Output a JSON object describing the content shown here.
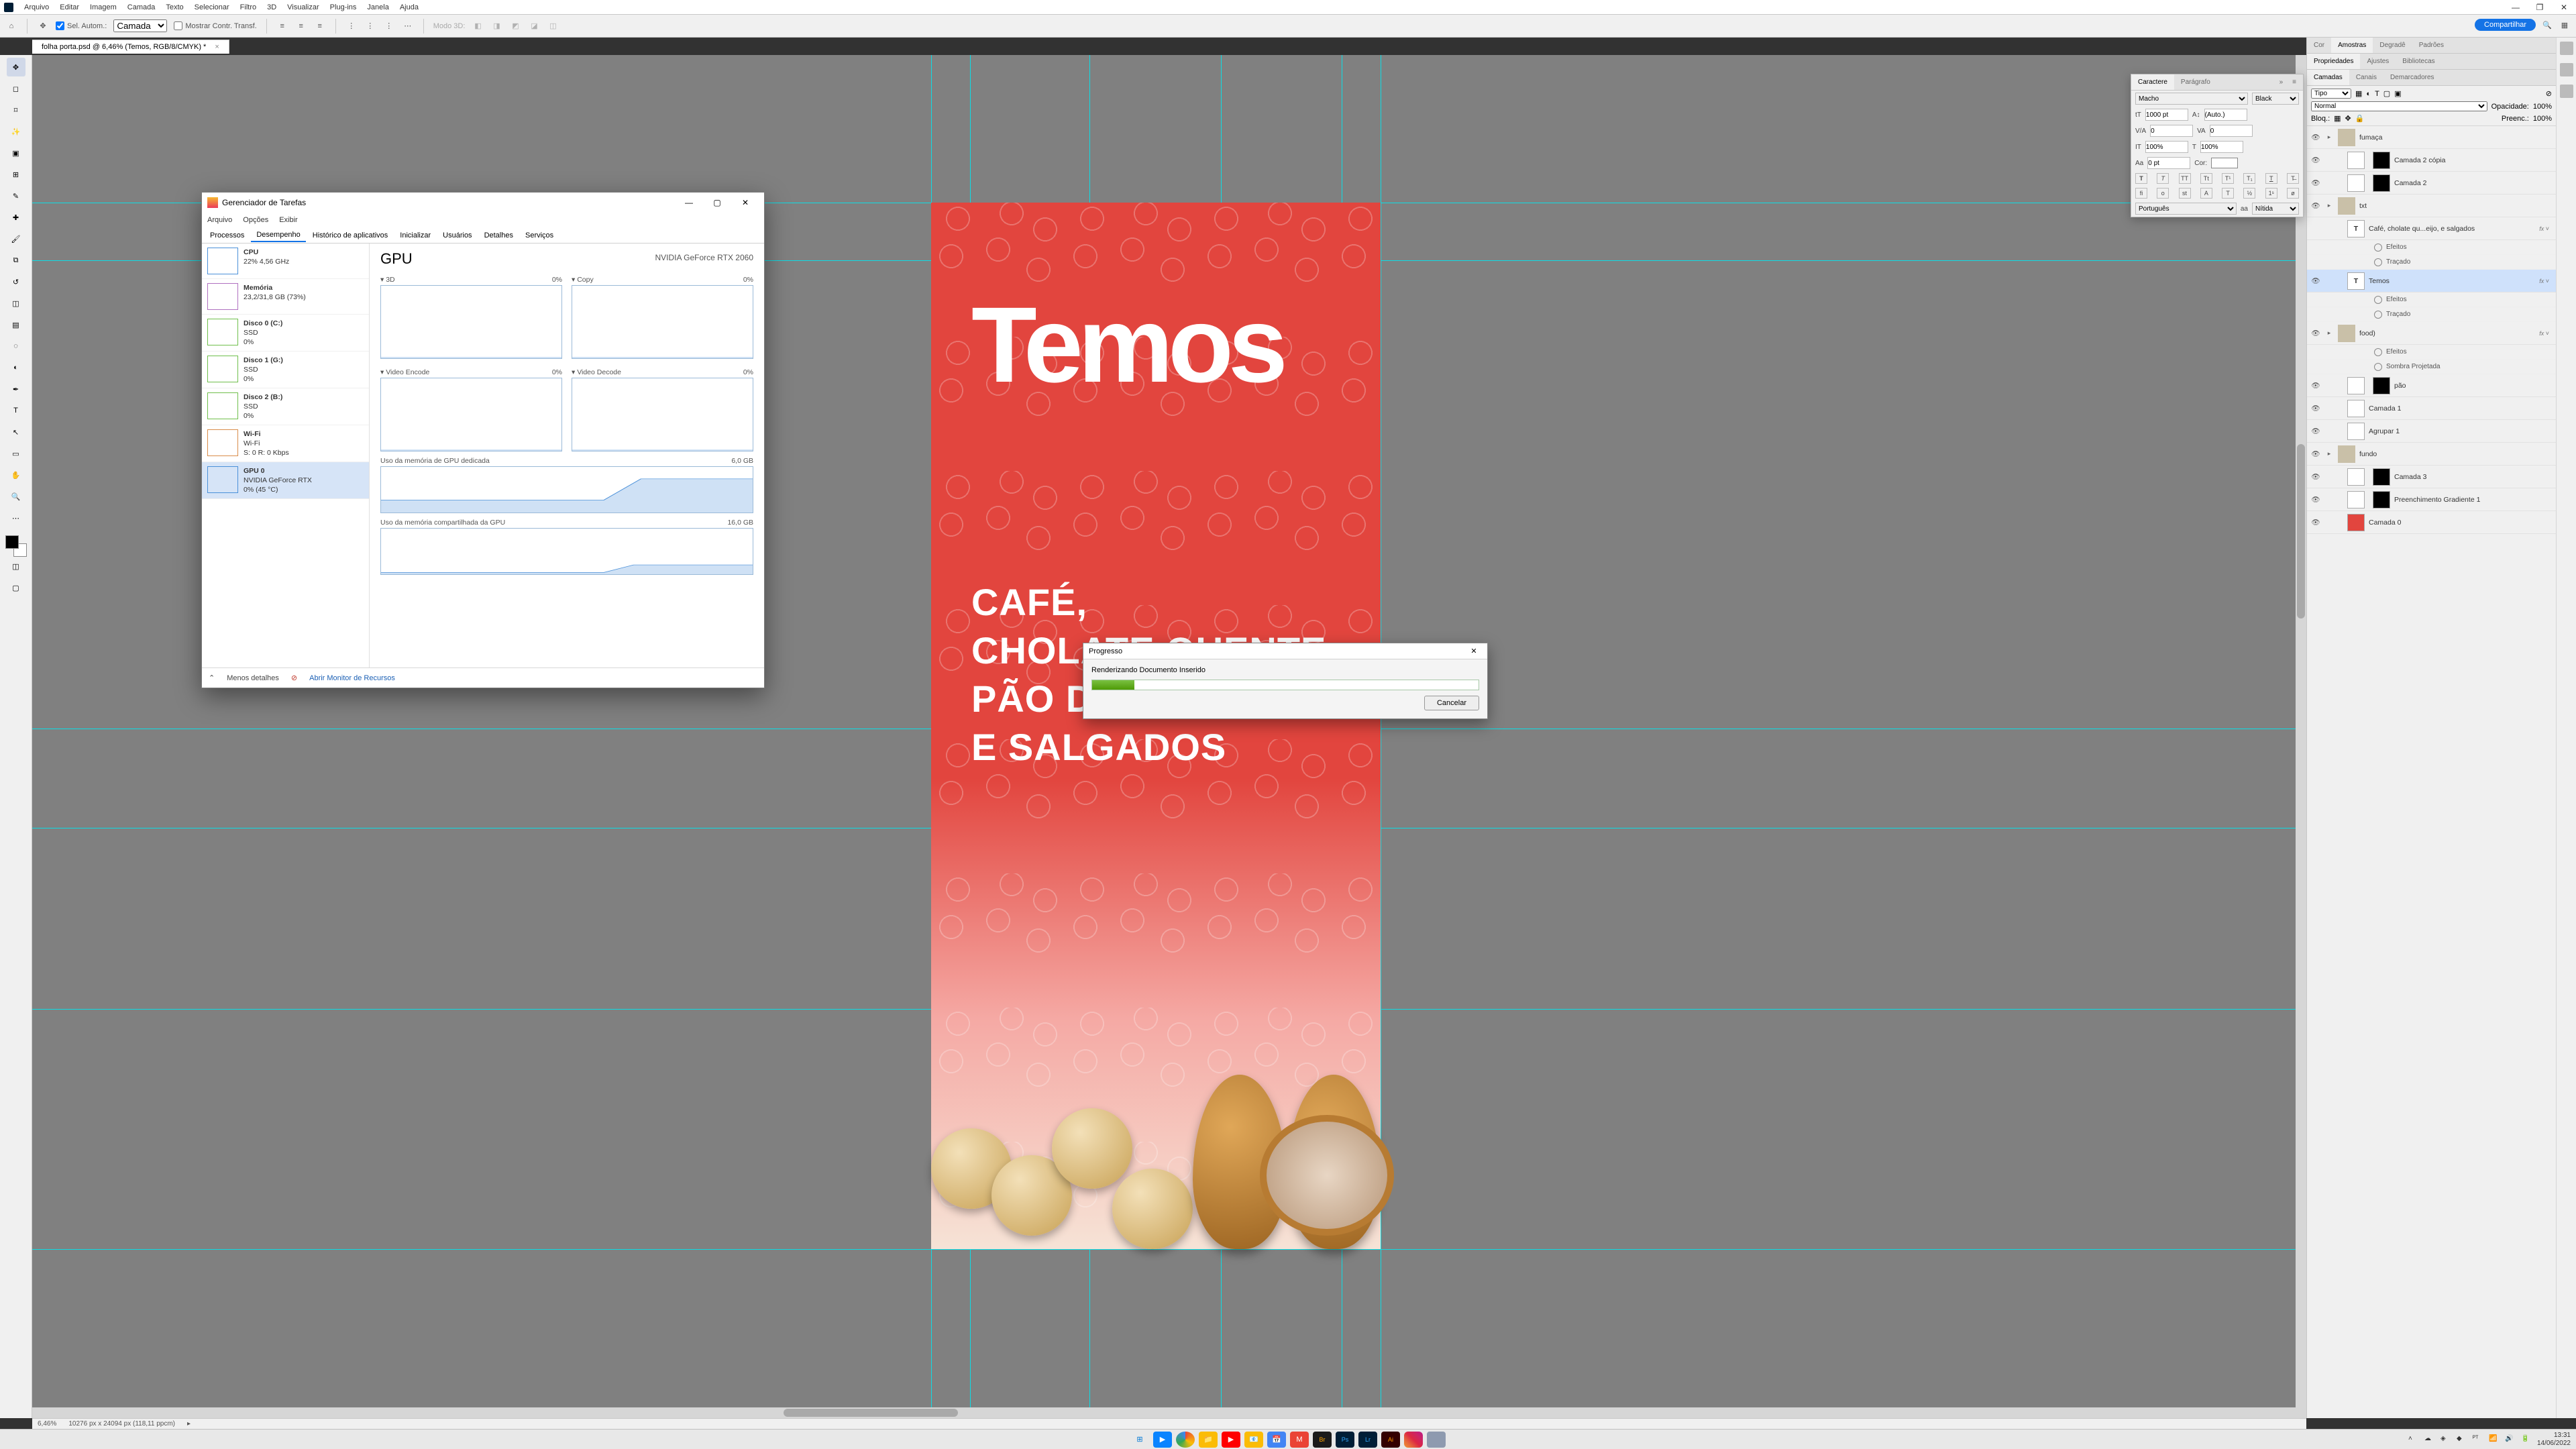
{
  "menubar": {
    "items": [
      "Arquivo",
      "Editar",
      "Imagem",
      "Camada",
      "Texto",
      "Selecionar",
      "Filtro",
      "3D",
      "Visualizar",
      "Plug-ins",
      "Janela",
      "Ajuda"
    ]
  },
  "window_buttons": {
    "minimize": "—",
    "restore": "❐",
    "close": "✕"
  },
  "optionsbar": {
    "auto_select_label": "Sel. Autom.:",
    "auto_select_dropdown": "Camada",
    "show_transform": "Mostrar Contr. Transf.",
    "mode_label": "Modo 3D:"
  },
  "share_button": "Compartilhar",
  "doc_tab": "folha porta.psd @ 6,46% (Temos, RGB/8/CMYK) *",
  "statusbar": {
    "zoom": "6,46%",
    "dims": "10276 px x 24094 px (118,11 ppcm)"
  },
  "char_panel": {
    "tabs": [
      "Caractere",
      "Parágrafo"
    ],
    "font_family": "Macho",
    "font_style": "Black",
    "font_size": "1000 pt",
    "leading": "(Auto.)",
    "va_metric": "0",
    "va_optical": "0",
    "vert_scale": "100%",
    "horz_scale": "100%",
    "baseline": "0 pt",
    "color_label": "Cor:",
    "lang": "Português",
    "aa": "Nítida"
  },
  "right_strip_top_tabs": [
    "Cor",
    "Amostras",
    "Degradê",
    "Padrões"
  ],
  "right_strip_mid_tabs": [
    "Propriedades",
    "Ajustes",
    "Bibliotecas"
  ],
  "layers_panel": {
    "tabs": [
      "Camadas",
      "Canais",
      "Demarcadores"
    ],
    "kind_label": "Tipo",
    "search_placeholder": "",
    "blend_mode": "Normal",
    "opacity_label": "Opacidade:",
    "opacity_value": "100%",
    "lock_label": "Bloq.:",
    "fill_label": "Preenc.:",
    "fill_value": "100%",
    "layers": [
      {
        "kind": "group",
        "name": "fumaça",
        "visible": true
      },
      {
        "kind": "raster",
        "name": "Camada 2 cópia",
        "visible": true,
        "masked": true
      },
      {
        "kind": "raster",
        "name": "Camada 2",
        "visible": true,
        "masked": true
      },
      {
        "kind": "group",
        "name": "txt",
        "visible": true
      },
      {
        "kind": "text",
        "name": "Café, cholate qu...eijo, e salgados",
        "visible": false,
        "fx": true
      },
      {
        "kind": "fxline",
        "name": "Efeitos"
      },
      {
        "kind": "fxline",
        "name": "Traçado"
      },
      {
        "kind": "text",
        "name": "Temos",
        "visible": true,
        "selected": true,
        "fx": true
      },
      {
        "kind": "fxline",
        "name": "Efeitos"
      },
      {
        "kind": "fxline",
        "name": "Traçado"
      },
      {
        "kind": "group",
        "name": "food)",
        "visible": true,
        "fx": true
      },
      {
        "kind": "fxline",
        "name": "Efeitos"
      },
      {
        "kind": "fxline",
        "name": "Sombra Projetada"
      },
      {
        "kind": "raster",
        "name": "pão",
        "visible": true,
        "masked": true
      },
      {
        "kind": "raster",
        "name": "Camada 1",
        "visible": true
      },
      {
        "kind": "raster",
        "name": "Agrupar 1",
        "visible": true
      },
      {
        "kind": "group",
        "name": "fundo",
        "visible": true
      },
      {
        "kind": "raster",
        "name": "Camada 3",
        "visible": true,
        "masked": true
      },
      {
        "kind": "adjust",
        "name": "Preenchimento Gradiente 1",
        "visible": true,
        "masked": true
      },
      {
        "kind": "solid",
        "name": "Camada 0",
        "visible": true
      }
    ]
  },
  "artwork": {
    "headline": "Temos",
    "subhead": "CAFÉ,\nCHOLATE QUENTE,\nPÃO DE QUEIJO,\nE SALGADOS"
  },
  "taskmgr": {
    "title": "Gerenciador de Tarefas",
    "menu": [
      "Arquivo",
      "Opções",
      "Exibir"
    ],
    "tabs": [
      "Processos",
      "Desempenho",
      "Histórico de aplicativos",
      "Inicializar",
      "Usuários",
      "Detalhes",
      "Serviços"
    ],
    "active_tab": "Desempenho",
    "side": [
      {
        "name": "CPU",
        "sub1": "22% 4,56 GHz",
        "color": "#4a90d9"
      },
      {
        "name": "Memória",
        "sub1": "23,2/31,8 GB (73%)",
        "color": "#b070c0"
      },
      {
        "name": "Disco 0 (C:)",
        "sub1": "SSD",
        "sub2": "0%",
        "color": "#6fbf4b"
      },
      {
        "name": "Disco 1 (G:)",
        "sub1": "SSD",
        "sub2": "0%",
        "color": "#6fbf4b"
      },
      {
        "name": "Disco 2 (B:)",
        "sub1": "SSD",
        "sub2": "0%",
        "color": "#6fbf4b"
      },
      {
        "name": "Wi-Fi",
        "sub1": "Wi-Fi",
        "sub2": "S: 0  R: 0 Kbps",
        "color": "#d98c4a"
      },
      {
        "name": "GPU 0",
        "sub1": "NVIDIA GeForce RTX",
        "sub2": "0% (45 °C)",
        "color": "#4a90d9",
        "selected": true
      }
    ],
    "gpu": {
      "heading": "GPU",
      "model": "NVIDIA GeForce RTX 2060",
      "cells": [
        {
          "label": "3D",
          "pct": "0%"
        },
        {
          "label": "Copy",
          "pct": "0%"
        },
        {
          "label": "Video Encode",
          "pct": "0%"
        },
        {
          "label": "Video Decode",
          "pct": "0%"
        }
      ],
      "wide1": {
        "label": "Uso da memória de GPU dedicada",
        "right": "6,0 GB"
      },
      "wide2": {
        "label": "Uso da memória compartilhada da GPU",
        "right": "16,0 GB"
      }
    },
    "foot_less": "Menos detalhes",
    "foot_link": "Abrir Monitor de Recursos"
  },
  "progress": {
    "title": "Progresso",
    "message": "Renderizando Documento Inserido",
    "cancel": "Cancelar"
  },
  "taskbar": {
    "apps": [
      "start",
      "edge",
      "chrome",
      "explorer",
      "youtube",
      "mail",
      "calendar",
      "gmail",
      "bridge",
      "photoshop",
      "lightroom",
      "illustrator",
      "instagram",
      "app"
    ],
    "time": "13:31",
    "date": "14/06/2022"
  }
}
